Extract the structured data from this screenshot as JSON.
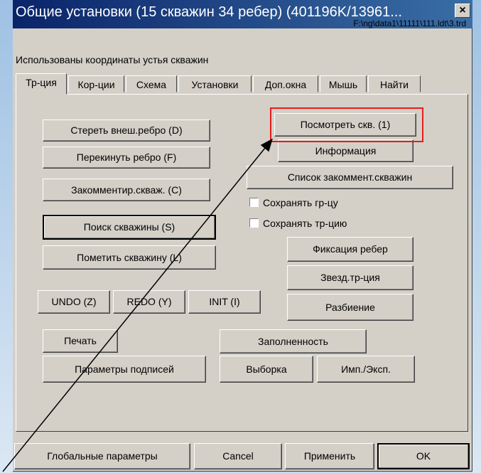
{
  "window": {
    "title": "Общие установки (15 скважин 34 ребер) (401196K/13961...",
    "path": "F:\\ng\\data1\\11111\\111.ldt\\3.trd",
    "close_icon": "×"
  },
  "subtitle": "Использованы координаты устья скважин",
  "tabs": [
    "Тр-ция",
    "Кор-ции",
    "Схема",
    "Установки",
    "Доп.окна",
    "Мышь",
    "Найти"
  ],
  "buttons": {
    "erase_edge": "Стереть внеш.ребро (D)",
    "flip_edge": "Перекинуть ребро (F)",
    "comment_well": "Закомментир.скваж. (C)",
    "search_well": "Поиск скважины (S)",
    "mark_well": "Пометить скважину (L)",
    "undo": "UNDO (Z)",
    "redo": "REDO (Y)",
    "init": "INIT (I)",
    "print": "Печать",
    "label_params": "Параметры подписей",
    "view_wells": "Посмотреть скв. (1)",
    "info": "Информация",
    "commented_list": "Список закоммент.скважин",
    "fix_edges": "Фиксация ребер",
    "star_tri": "Звезд.тр-ция",
    "split": "Разбиение",
    "fill": "Заполненность",
    "sample": "Выборка",
    "import_export": "Имп./Эксп."
  },
  "checkboxes": {
    "save_border": "Сохранять гр-цу",
    "save_tri": "Сохранять тр-цию"
  },
  "footer": {
    "global_params": "Глобальные параметры",
    "cancel": "Cancel",
    "apply": "Применить",
    "ok": "OK"
  },
  "colors": {
    "title_bar": "#0a246a",
    "face": "#d4d0c8",
    "highlight": "#e81c1c"
  }
}
